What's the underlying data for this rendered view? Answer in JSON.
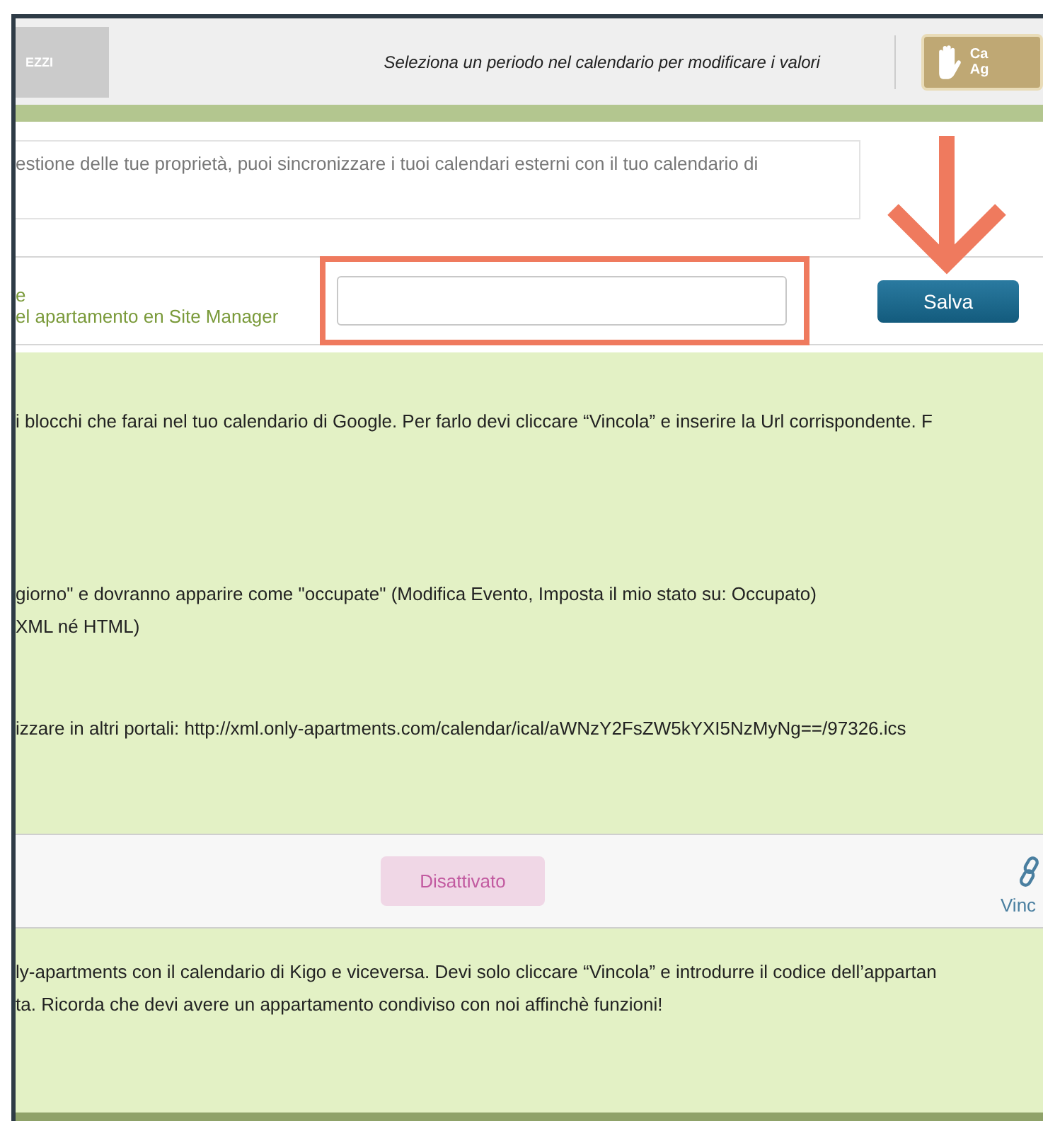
{
  "toolbar": {
    "tab_button": "EZZI",
    "hint": "Seleziona un periodo nel calendario per modificare i valori",
    "action_button": {
      "lines": [
        "Ca",
        "Ag"
      ]
    }
  },
  "intro": "estione delle tue proprietà, puoi sincronizzare i tuoi calendari esterni con il tuo calendario di",
  "site_manager": {
    "label_lines": [
      "e",
      "el apartamento en Site Manager"
    ],
    "url_field": {
      "highlighted": true
    },
    "save_button": {
      "label": "Salva",
      "pointed_by_arrow": true
    }
  },
  "google_info": [
    [
      "i blocchi che farai nel tuo calendario di Google. Per farlo devi cliccare “Vincola” e inserire la Url corrispondente. F"
    ],
    [
      "giorno\" e dovranno apparire come \"occupate\" (Modifica Evento, Imposta il mio stato su: Occupato)",
      "XML né HTML)"
    ],
    [
      "izzare in altri portali: http://xml.only-apartments.com/calendar/ical/aWNzY2FsZW5kYXI5NzMyNg==/97326.ics"
    ]
  ],
  "kigo": {
    "status": "Disattivato",
    "link_label": "Vinc",
    "info": [
      "ly-apartments con il calendario di Kigo e viceversa. Devi solo cliccare “Vincola” e introdurre il codice dell’appartan",
      "ta. Ricorda che devi avere un appartamento condiviso con noi affinchè funzioni!"
    ]
  }
}
